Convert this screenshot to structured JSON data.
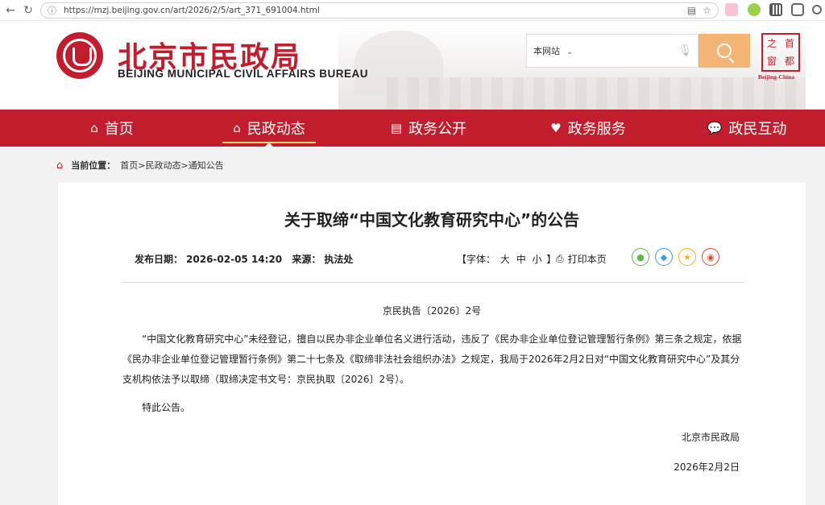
{
  "browser": {
    "url": "https://mzj.beijing.gov.cn/art/2026/2/5/art_371_691004.html"
  },
  "header": {
    "site_name": "北京市民政局",
    "site_name_en": "BEIJING MUNICIPAL CIVIL AFFAIRS BUREAU",
    "search_scope": "本网站",
    "seal_chars": [
      "之",
      "首",
      "窗",
      "都"
    ],
    "seal_caption": "Beijing-China"
  },
  "nav": {
    "items": [
      {
        "label": "首页",
        "icon": "home-icon"
      },
      {
        "label": "民政动态",
        "icon": "building-icon"
      },
      {
        "label": "政务公开",
        "icon": "list-icon"
      },
      {
        "label": "政务服务",
        "icon": "heart-icon"
      },
      {
        "label": "政民互动",
        "icon": "chat-icon"
      }
    ],
    "active_index": 1
  },
  "breadcrumb": {
    "label": "当前位置：",
    "path": "首页>民政动态>通知公告"
  },
  "article": {
    "title": "关于取缔“中国文化教育研究中心”的公告",
    "date_label": "发布日期：",
    "date": "2026-02-05 14:20",
    "source_label": "来源：",
    "source": "执法处",
    "font_label": "【字体：",
    "font_sizes": [
      "大",
      "中",
      "小"
    ],
    "font_end": "】",
    "print_label": "打印本页",
    "doc_no": "京民执告〔2026〕2号",
    "body": "“中国文化教育研究中心”未经登记，擅自以民办非企业单位名义进行活动，违反了《民办非企业单位登记管理暂行条例》第三条之规定，依据《民办非企业单位登记管理暂行条例》第二十七条及《取缔非法社会组织办法》之规定，我局于2026年2月2日对“中国文化教育研究中心”及其分支机构依法予以取缔（取缔决定书文号：京民执取〔2026〕2号）。",
    "closing": "特此公告。",
    "signature": "北京市民政局",
    "sign_date": "2026年2月2日"
  },
  "colors": {
    "brand_red": "#c21d2c",
    "search_btn": "#f3b476"
  }
}
